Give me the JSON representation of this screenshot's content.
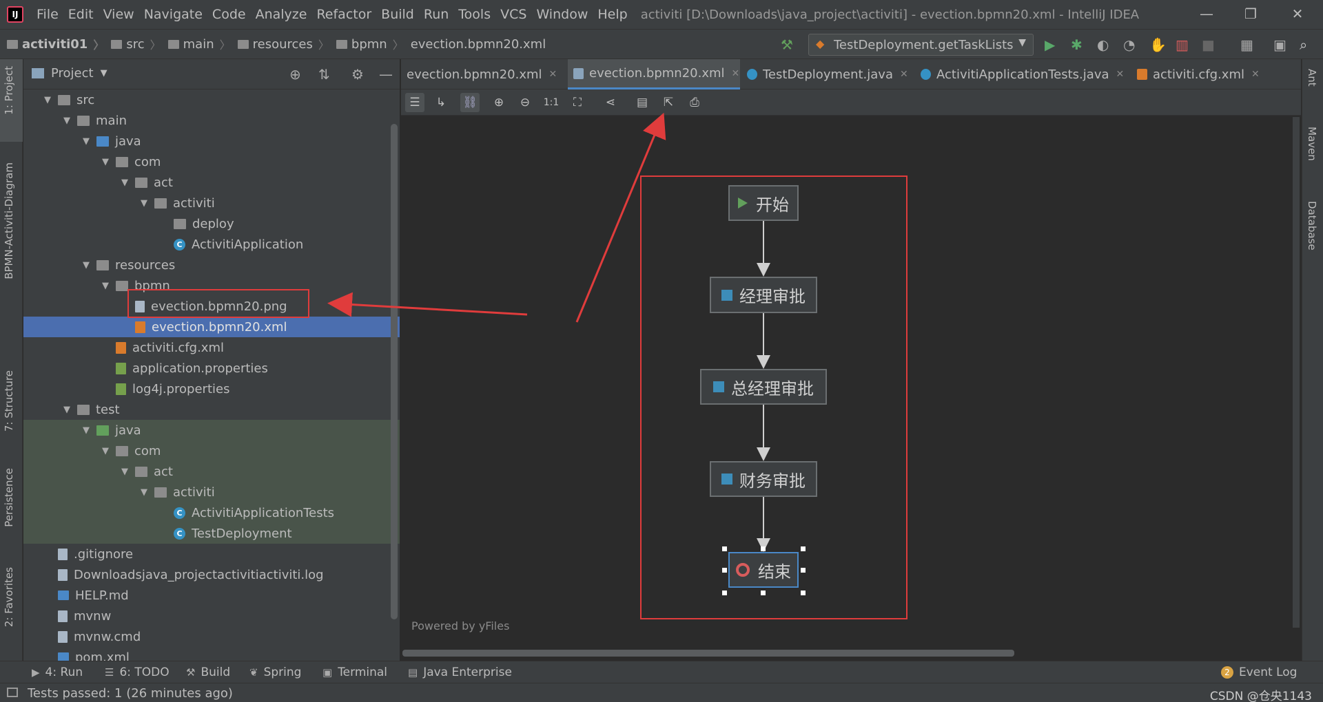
{
  "window": {
    "title": "activiti [D:\\Downloads\\java_project\\activiti] - evection.bpmn20.xml - IntelliJ IDEA",
    "app_icon": "IJ"
  },
  "menu": [
    "File",
    "Edit",
    "View",
    "Navigate",
    "Code",
    "Analyze",
    "Refactor",
    "Build",
    "Run",
    "Tools",
    "VCS",
    "Window",
    "Help"
  ],
  "breadcrumb": [
    "activiti01",
    "src",
    "main",
    "resources",
    "bpmn",
    "evection.bpmn20.xml"
  ],
  "run_config": "TestDeployment.getTaskLists",
  "project_panel": {
    "title": "Project",
    "tree": [
      {
        "label": "src",
        "icon": "folder",
        "expanded": true
      },
      {
        "label": "main",
        "icon": "folder",
        "expanded": true
      },
      {
        "label": "java",
        "icon": "bluefolder",
        "expanded": true
      },
      {
        "label": "com",
        "icon": "pkg",
        "expanded": true
      },
      {
        "label": "act",
        "icon": "pkg",
        "expanded": true
      },
      {
        "label": "activiti",
        "icon": "pkg",
        "expanded": true
      },
      {
        "label": "deploy",
        "icon": "pkg"
      },
      {
        "label": "ActivitiApplication",
        "icon": "cls"
      },
      {
        "label": "resources",
        "icon": "folder",
        "expanded": true
      },
      {
        "label": "bpmn",
        "icon": "folder",
        "expanded": true
      },
      {
        "label": "evection.bpmn20.png",
        "icon": "file"
      },
      {
        "label": "evection.bpmn20.xml",
        "icon": "xml",
        "selected": true
      },
      {
        "label": "activiti.cfg.xml",
        "icon": "xml"
      },
      {
        "label": "application.properties",
        "icon": "prop"
      },
      {
        "label": "log4j.properties",
        "icon": "prop"
      },
      {
        "label": "test",
        "icon": "folder",
        "expanded": true
      },
      {
        "label": "java",
        "icon": "greenfolder",
        "expanded": true
      },
      {
        "label": "com",
        "icon": "pkg",
        "expanded": true
      },
      {
        "label": "act",
        "icon": "pkg",
        "expanded": true
      },
      {
        "label": "activiti",
        "icon": "pkg",
        "expanded": true
      },
      {
        "label": "ActivitiApplicationTests",
        "icon": "cls"
      },
      {
        "label": "TestDeployment",
        "icon": "cls"
      },
      {
        "label": ".gitignore",
        "icon": "file"
      },
      {
        "label": "Downloadsjava_projectactivitiactiviti.log",
        "icon": "file"
      },
      {
        "label": "HELP.md",
        "icon": "md"
      },
      {
        "label": "mvnw",
        "icon": "file"
      },
      {
        "label": "mvnw.cmd",
        "icon": "file"
      },
      {
        "label": "pom.xml",
        "icon": "md"
      }
    ]
  },
  "tabs": [
    {
      "label": "evection.bpmn20.xml",
      "active": false
    },
    {
      "label": "evection.bpmn20.xml",
      "active": true
    },
    {
      "label": "TestDeployment.java",
      "active": false
    },
    {
      "label": "ActivitiApplicationTests.java",
      "active": false
    },
    {
      "label": "activiti.cfg.xml",
      "active": false
    }
  ],
  "diagram": {
    "powered_by": "Powered by yFiles",
    "nodes": [
      {
        "label": "开始",
        "kind": "start"
      },
      {
        "label": "经理审批",
        "kind": "task"
      },
      {
        "label": "总经理审批",
        "kind": "task"
      },
      {
        "label": "财务审批",
        "kind": "task"
      },
      {
        "label": "结束",
        "kind": "end"
      }
    ],
    "zoom_label": "1:1"
  },
  "left_strip": [
    "1: Project",
    "BPMN-Activiti-Diagram",
    "7: Structure",
    "Persistence",
    "2: Favorites"
  ],
  "right_strip": [
    "Ant",
    "Maven",
    "Database"
  ],
  "bottom_tools": [
    {
      "label": "4: Run",
      "icon": "▶"
    },
    {
      "label": "6: TODO",
      "icon": "☰"
    },
    {
      "label": "Build",
      "icon": "⚒"
    },
    {
      "label": "Spring",
      "icon": "❦"
    },
    {
      "label": "Terminal",
      "icon": "▣"
    },
    {
      "label": "Java Enterprise",
      "icon": "▤"
    }
  ],
  "event_log": {
    "label": "Event Log",
    "count": "2"
  },
  "status": "Tests passed: 1 (26 minutes ago)",
  "watermark": "CSDN @仓央1143",
  "colors": {
    "accent": "#4b6eaf",
    "annotation": "#e03c3c",
    "task_mark": "#3d8db9"
  }
}
